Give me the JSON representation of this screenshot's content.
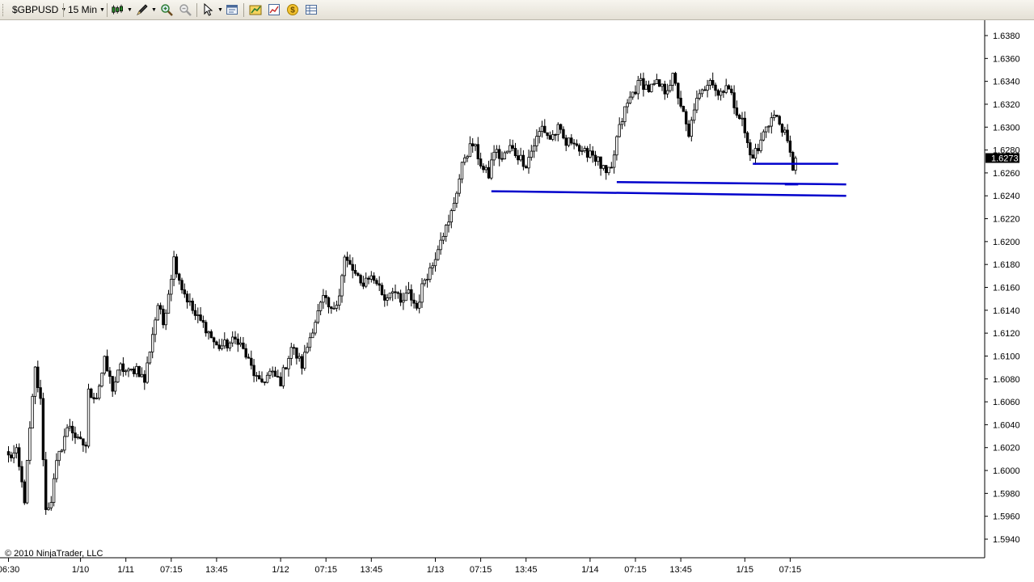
{
  "toolbar": {
    "symbol": "$GBPUSD",
    "interval": "15 Min",
    "icons": [
      "candlestick-chart-icon",
      "drawing-pen-icon",
      "zoom-in-icon",
      "zoom-out-icon",
      "cursor-icon",
      "properties-icon",
      "strategies-icon",
      "indicators-icon",
      "currency-icon",
      "data-box-icon"
    ]
  },
  "footer": {
    "copyright": "© 2010 NinjaTrader, LLC"
  },
  "colors": {
    "line": "#0000cc",
    "candle": "#000000",
    "axis": "#000000",
    "background": "#ffffff"
  },
  "chart_data": {
    "type": "candlestick",
    "instrument": "$GBPUSD",
    "interval": "15 Min",
    "ylim": [
      1.593,
      1.6389
    ],
    "y_ticks": [
      "1.6380",
      "1.6360",
      "1.6340",
      "1.6320",
      "1.6300",
      "1.6280",
      "1.6260",
      "1.6240",
      "1.6220",
      "1.6200",
      "1.6180",
      "1.6160",
      "1.6140",
      "1.6120",
      "1.6100",
      "1.6080",
      "1.6060",
      "1.6040",
      "1.6020",
      "1.6000",
      "1.5980",
      "1.5960",
      "1.5940"
    ],
    "current_price": "1.6273",
    "x_labels": [
      "06:30",
      "1/10",
      "1/11",
      "07:15",
      "13:45",
      "1/12",
      "07:15",
      "13:45",
      "1/13",
      "07:15",
      "13:45",
      "1/14",
      "07:15",
      "13:45",
      "1/15",
      "07:15"
    ],
    "price_path": [
      [
        0,
        1.6012
      ],
      [
        3,
        1.6015
      ],
      [
        6,
        1.5975
      ],
      [
        8,
        1.6035
      ],
      [
        10,
        1.6088
      ],
      [
        12,
        1.606
      ],
      [
        14,
        1.5965
      ],
      [
        16,
        1.5975
      ],
      [
        18,
        1.6005
      ],
      [
        21,
        1.603
      ],
      [
        23,
        1.604
      ],
      [
        26,
        1.6025
      ],
      [
        29,
        1.6022
      ],
      [
        30,
        1.6068
      ],
      [
        33,
        1.6065
      ],
      [
        36,
        1.6095
      ],
      [
        39,
        1.6072
      ],
      [
        42,
        1.609
      ],
      [
        45,
        1.6085
      ],
      [
        48,
        1.609
      ],
      [
        51,
        1.6078
      ],
      [
        54,
        1.612
      ],
      [
        56,
        1.6145
      ],
      [
        58,
        1.6128
      ],
      [
        62,
        1.6185
      ],
      [
        65,
        1.616
      ],
      [
        70,
        1.6135
      ],
      [
        74,
        1.6125
      ],
      [
        78,
        1.6108
      ],
      [
        82,
        1.611
      ],
      [
        86,
        1.6115
      ],
      [
        90,
        1.6095
      ],
      [
        94,
        1.6075
      ],
      [
        98,
        1.6085
      ],
      [
        102,
        1.6078
      ],
      [
        106,
        1.6108
      ],
      [
        110,
        1.6092
      ],
      [
        114,
        1.6125
      ],
      [
        118,
        1.615
      ],
      [
        121,
        1.6138
      ],
      [
        124,
        1.6155
      ],
      [
        126,
        1.6185
      ],
      [
        129,
        1.6175
      ],
      [
        132,
        1.6162
      ],
      [
        135,
        1.617
      ],
      [
        138,
        1.6165
      ],
      [
        141,
        1.615
      ],
      [
        144,
        1.616
      ],
      [
        147,
        1.6145
      ],
      [
        150,
        1.6155
      ],
      [
        153,
        1.6142
      ],
      [
        156,
        1.6168
      ],
      [
        159,
        1.618
      ],
      [
        162,
        1.6205
      ],
      [
        165,
        1.6215
      ],
      [
        168,
        1.6245
      ],
      [
        171,
        1.6275
      ],
      [
        174,
        1.6285
      ],
      [
        176,
        1.6275
      ],
      [
        178,
        1.6262
      ],
      [
        180,
        1.6258
      ],
      [
        182,
        1.628
      ],
      [
        185,
        1.6272
      ],
      [
        188,
        1.6282
      ],
      [
        191,
        1.6275
      ],
      [
        194,
        1.6268
      ],
      [
        197,
        1.6285
      ],
      [
        200,
        1.63
      ],
      [
        203,
        1.629
      ],
      [
        206,
        1.6298
      ],
      [
        209,
        1.6285
      ],
      [
        212,
        1.629
      ],
      [
        215,
        1.6275
      ],
      [
        218,
        1.628
      ],
      [
        221,
        1.627
      ],
      [
        224,
        1.6258
      ],
      [
        226,
        1.6262
      ],
      [
        228,
        1.629
      ],
      [
        231,
        1.6315
      ],
      [
        234,
        1.633
      ],
      [
        237,
        1.634
      ],
      [
        240,
        1.6333
      ],
      [
        243,
        1.6337
      ],
      [
        246,
        1.6332
      ],
      [
        249,
        1.6343
      ],
      [
        252,
        1.632
      ],
      [
        255,
        1.629
      ],
      [
        257,
        1.6318
      ],
      [
        260,
        1.633
      ],
      [
        263,
        1.6345
      ],
      [
        266,
        1.6328
      ],
      [
        269,
        1.6338
      ],
      [
        272,
        1.632
      ],
      [
        275,
        1.6305
      ],
      [
        278,
        1.6275
      ],
      [
        281,
        1.628
      ],
      [
        284,
        1.6302
      ],
      [
        287,
        1.631
      ],
      [
        290,
        1.63
      ],
      [
        292,
        1.6285
      ],
      [
        294,
        1.6265
      ],
      [
        295,
        1.6273
      ]
    ],
    "horizontal_lines": [
      {
        "from_price": 1.6244,
        "to_price": 1.624,
        "from_bar": 181,
        "to_bar": 314
      },
      {
        "from_price": 1.6252,
        "to_price": 1.625,
        "from_bar": 228,
        "to_bar": 314
      },
      {
        "from_price": 1.6268,
        "to_price": 1.6268,
        "from_bar": 279,
        "to_bar": 311
      },
      {
        "from_price": 1.625,
        "to_price": 1.625,
        "from_bar": 291,
        "to_bar": 296
      }
    ]
  }
}
